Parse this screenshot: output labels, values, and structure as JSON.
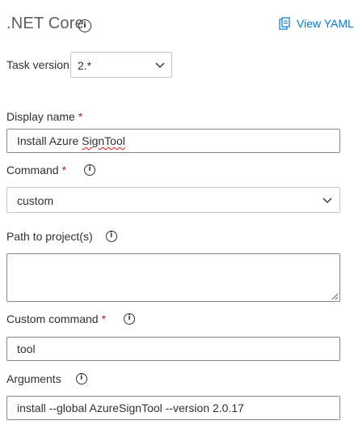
{
  "header": {
    "title": ".NET Core",
    "view_yaml_label": "View YAML"
  },
  "task_version": {
    "label": "Task version",
    "value": "2.*"
  },
  "fields": {
    "display_name": {
      "label": "Display name",
      "required_mark": "*",
      "value_prefix": "Install Azure ",
      "value_misspelled": "SignTool"
    },
    "command": {
      "label": "Command",
      "required_mark": "*",
      "value": "custom"
    },
    "path_to_projects": {
      "label": "Path to project(s)",
      "value": ""
    },
    "custom_command": {
      "label": "Custom command",
      "required_mark": "*",
      "value": "tool"
    },
    "arguments": {
      "label": "Arguments",
      "value": "install --global AzureSignTool --version 2.0.17"
    }
  },
  "icons": {
    "info": "i",
    "yaml": "clipboard-icon",
    "dropdown": "chevron-down-icon"
  },
  "colors": {
    "link": "#0078d4",
    "required": "#a4262c",
    "text": "#323130",
    "spellcheck": "#e81123"
  }
}
